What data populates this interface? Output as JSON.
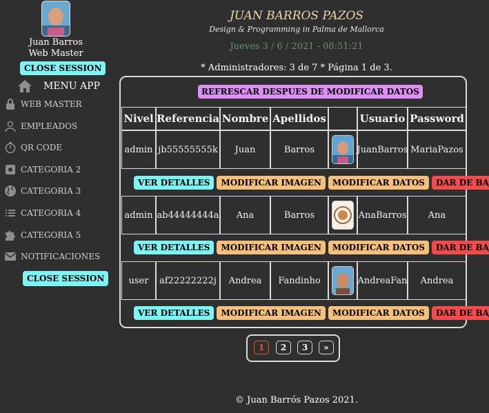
{
  "sidebar": {
    "user_name": "Juan Barros",
    "user_role": "Web Master",
    "close_top": "CLOSE SESSION",
    "menu_title": "MENU APP",
    "items": [
      {
        "label": "WEB MASTER",
        "icon": "lock-icon"
      },
      {
        "label": "EMPLEADOS",
        "icon": "person-icon"
      },
      {
        "label": "QR CODE",
        "icon": "timer-icon"
      },
      {
        "label": "CATEGORIA 2",
        "icon": "gear-icon"
      },
      {
        "label": "CATEGORIA 3",
        "icon": "globe-icon"
      },
      {
        "label": "CATEGORIA 4",
        "icon": "list-icon"
      },
      {
        "label": "CATEGORIA 5",
        "icon": "puzzle-icon"
      },
      {
        "label": "NOTIFICACIONES",
        "icon": "mail-icon"
      }
    ],
    "close_bottom": "CLOSE SESSION"
  },
  "header": {
    "title": "JUAN BARROS PAZOS",
    "subtitle": "Design & Programming in Palma de Mallorca",
    "datetime": "Jueves 3 / 6 / 2021 - 08:51:21",
    "summary": "* Administradores: 3 de 7 * Página 1 de 3."
  },
  "table": {
    "refresh_label": "REFRESCAR DESPUES DE MODIFICAR DATOS",
    "columns": [
      "Nivel",
      "Referencia",
      "Nombre",
      "Apellidos",
      "",
      "Usuario",
      "Password"
    ],
    "rows": [
      {
        "nivel": "admin",
        "referencia": "jb55555555k",
        "nombre": "Juan",
        "apellidos": "Barros",
        "usuario": "JuanBarros",
        "password": "MariaPazos"
      },
      {
        "nivel": "admin",
        "referencia": "ab44444444a",
        "nombre": "Ana",
        "apellidos": "Barros",
        "usuario": "AnaBarros",
        "password": "Ana"
      },
      {
        "nivel": "user",
        "referencia": "af22222222j",
        "nombre": "Andrea",
        "apellidos": "Fandinho",
        "usuario": "AndreaFan",
        "password": "Andrea"
      }
    ],
    "actions": {
      "details": "VER DETALLES",
      "modify_image": "MODIFICAR IMAGEN",
      "modify_data": "MODIFICAR DATOS",
      "delete": "DAR DE BAJA"
    }
  },
  "pagination": {
    "pages": [
      "1",
      "2",
      "3"
    ],
    "next": "»",
    "current": "1"
  },
  "footer": "© Juan Barrós Pazos 2021.",
  "colors": {
    "accent_cyan": "#7ef3f3",
    "accent_orange": "#f7c07a",
    "accent_red": "#f24b4b",
    "accent_purple": "#de8ff5",
    "header_gold": "#e8d9a8"
  }
}
